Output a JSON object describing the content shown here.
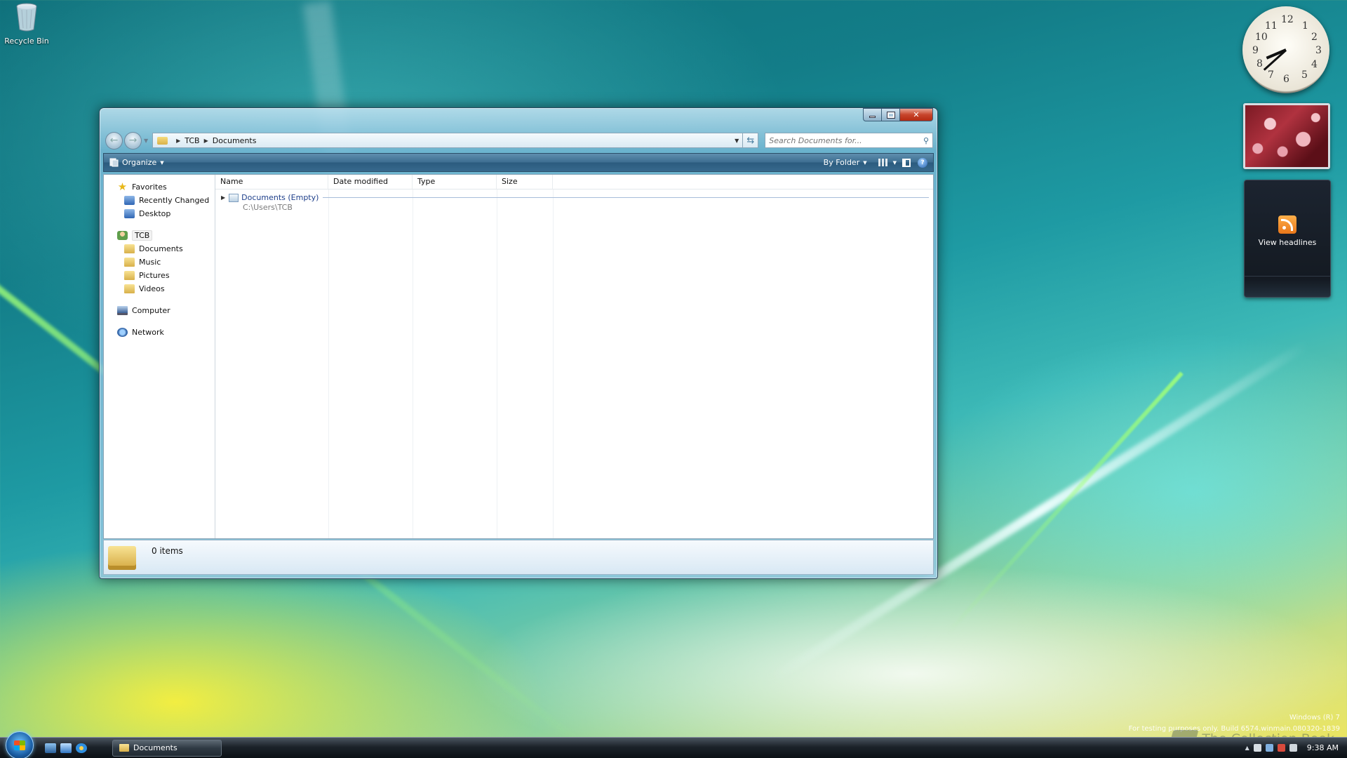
{
  "desktop": {
    "recycle_bin_label": "Recycle Bin"
  },
  "window": {
    "address": {
      "segments": [
        "TCB",
        "Documents"
      ]
    },
    "search": {
      "placeholder": "Search Documents for..."
    },
    "toolbar": {
      "organize_label": "Organize",
      "by_folder_label": "By Folder"
    },
    "navpane": {
      "favorites_label": "Favorites",
      "recently_changed_label": "Recently Changed",
      "desktop_label": "Desktop",
      "user_label": "TCB",
      "documents_label": "Documents",
      "music_label": "Music",
      "pictures_label": "Pictures",
      "videos_label": "Videos",
      "computer_label": "Computer",
      "network_label": "Network"
    },
    "columns": {
      "name": "Name",
      "date_modified": "Date modified",
      "type": "Type",
      "size": "Size"
    },
    "group": {
      "title": "Documents (Empty)",
      "path": "C:\\Users\\TCB"
    },
    "details": {
      "item_count": "0 items"
    }
  },
  "gadgets": {
    "feed_label": "View headlines",
    "clock_numbers": [
      "12",
      "1",
      "2",
      "3",
      "4",
      "5",
      "6",
      "7",
      "8",
      "9",
      "10",
      "11"
    ]
  },
  "watermark": {
    "line1": "Windows (R) 7",
    "line2": "For testing purposes only. Build 6574.winmain.080320-1839",
    "brand": "The Collection Book"
  },
  "taskbar": {
    "task_label": "Documents",
    "time": "9:38 AM"
  },
  "colors": {
    "accent": "#3c6d90",
    "close_button": "#c7442b"
  }
}
